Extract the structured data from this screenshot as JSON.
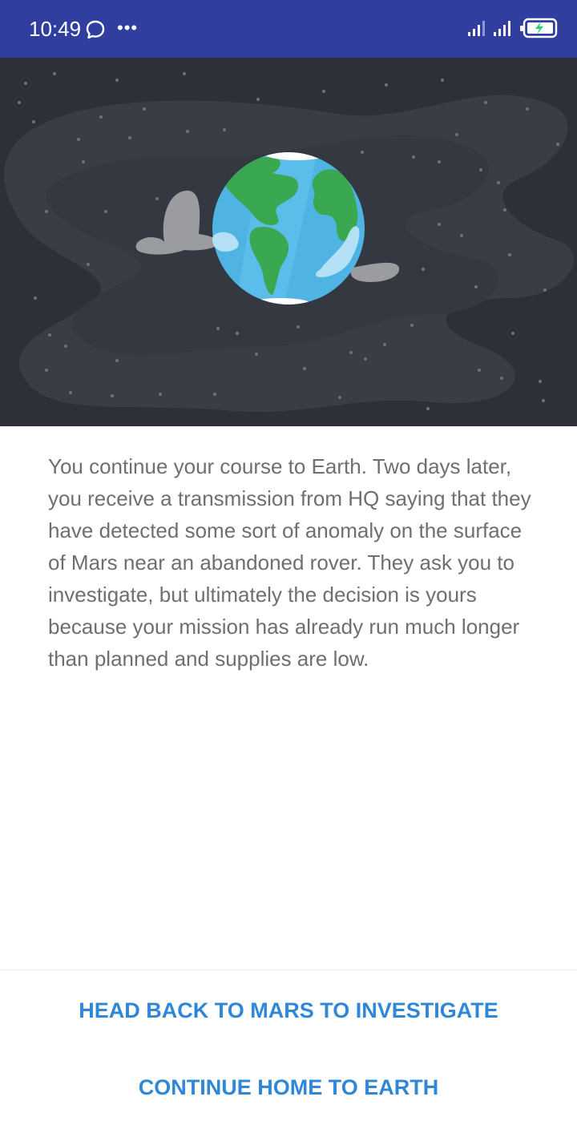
{
  "status_bar": {
    "time": "10:49",
    "icons": [
      "chat-bubble-icon",
      "more-icon",
      "signal-icon",
      "signal-icon",
      "battery-charging-icon"
    ],
    "colors": {
      "background": "#303f9f",
      "foreground": "#ffffff",
      "battery_charge": "#2ecc71"
    }
  },
  "hero": {
    "illustration": "earth-in-space-icon",
    "colors": {
      "space": "#2d3038",
      "ocean": "#4fb3e4",
      "land": "#3aa851",
      "cloud": "#9a9ca0"
    }
  },
  "story": {
    "text": "You continue your course to Earth. Two days later, you receive a transmission from HQ saying that they have detected some sort of anomaly on the surface of Mars near an abandoned rover. They ask you to investigate, but ultimately the decision is yours because your mission has already run much longer than planned and supplies are low."
  },
  "choices": [
    {
      "label": "HEAD BACK TO MARS TO INVESTIGATE"
    },
    {
      "label": "CONTINUE HOME TO EARTH"
    }
  ],
  "theme": {
    "accent": "#2f87d8",
    "body_text": "#6f6f6f"
  }
}
